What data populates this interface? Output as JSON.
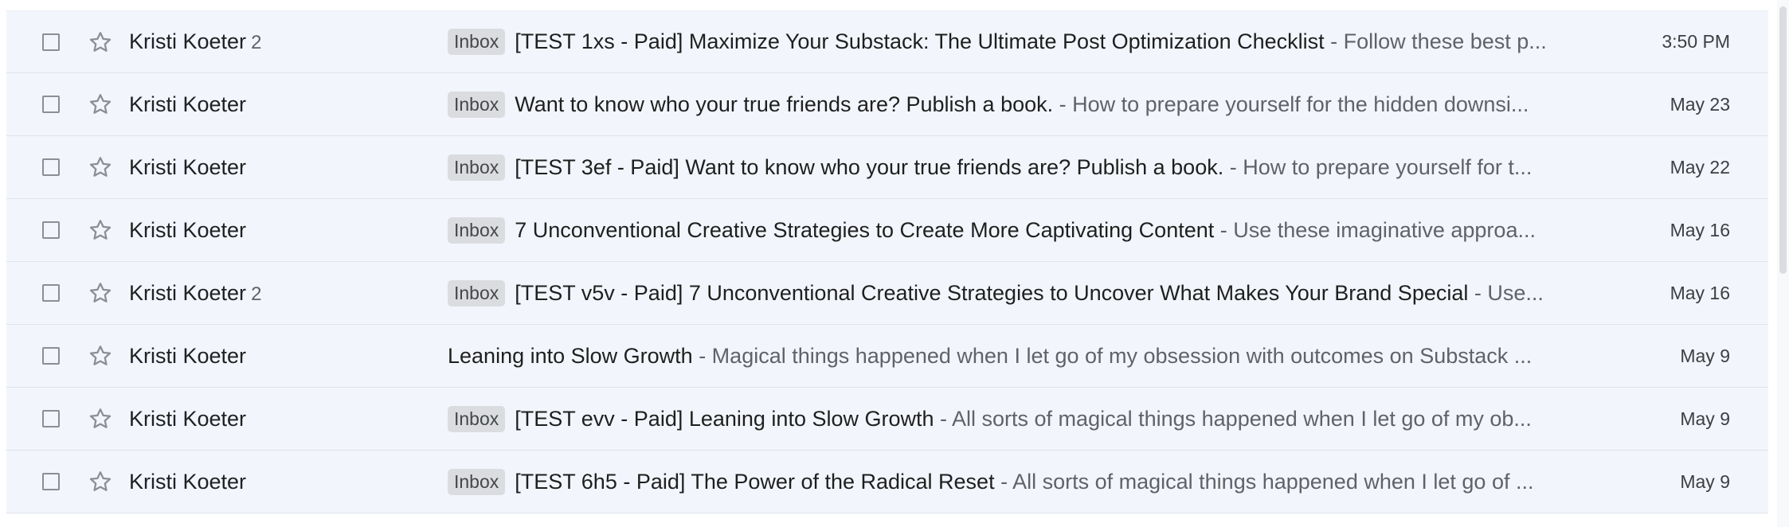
{
  "inbox": {
    "rows": [
      {
        "sender": "Kristi Koeter",
        "count": "2",
        "label": "Inbox",
        "subject": "[TEST 1xs - Paid] Maximize Your Substack: The Ultimate Post Optimization Checklist",
        "snippet": " - Follow these best p...",
        "date": "3:50 PM"
      },
      {
        "sender": "Kristi Koeter",
        "label": "Inbox",
        "subject": "Want to know who your true friends are? Publish a book.",
        "snippet": " - How to prepare yourself for the hidden downsi...",
        "date": "May 23"
      },
      {
        "sender": "Kristi Koeter",
        "label": "Inbox",
        "subject": "[TEST 3ef - Paid] Want to know who your true friends are? Publish a book.",
        "snippet": " - How to prepare yourself for t...",
        "date": "May 22"
      },
      {
        "sender": "Kristi Koeter",
        "label": "Inbox",
        "subject": "7 Unconventional Creative Strategies to Create More Captivating Content",
        "snippet": " - Use these imaginative approa...",
        "date": "May 16"
      },
      {
        "sender": "Kristi Koeter",
        "count": "2",
        "label": "Inbox",
        "subject": "[TEST v5v - Paid] 7 Unconventional Creative Strategies to Uncover What Makes Your Brand Special",
        "snippet": " - Use...",
        "date": "May 16"
      },
      {
        "sender": "Kristi Koeter",
        "subject": "Leaning into Slow Growth",
        "snippet": " - Magical things happened when I let go of my obsession with outcomes on Substack ...",
        "date": "May 9"
      },
      {
        "sender": "Kristi Koeter",
        "label": "Inbox",
        "subject": "[TEST evv - Paid] Leaning into Slow Growth",
        "snippet": " - All sorts of magical things happened when I let go of my ob...",
        "date": "May 9"
      },
      {
        "sender": "Kristi Koeter",
        "label": "Inbox",
        "subject": "[TEST 6h5 - Paid] The Power of the Radical Reset",
        "snippet": " - All sorts of magical things happened when I let go of ...",
        "date": "May 9"
      }
    ]
  },
  "icons": {
    "checkbox": "checkbox-icon",
    "star": "star-outline-icon"
  },
  "colors": {
    "row_background": "#f2f6fc",
    "divider": "#dfe3ea",
    "badge_background": "#dadce0",
    "snippet_text": "#5f6368",
    "primary_text": "#202124"
  }
}
